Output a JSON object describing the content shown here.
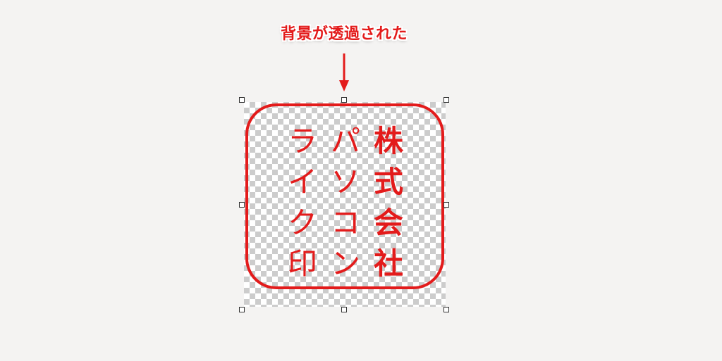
{
  "annotation": {
    "label": "背景が透過された"
  },
  "stamp": {
    "columns": [
      "株式会社",
      "パソコン",
      "ライク印"
    ]
  },
  "colors": {
    "stamp_red": "#e31b1b",
    "checker_dark": "#cccccc",
    "checker_light": "#ffffff",
    "background": "#f4f3f2",
    "handle_border": "#333333"
  },
  "icons": {
    "arrow": "arrow-down-icon",
    "handle": "resize-handle-icon"
  }
}
